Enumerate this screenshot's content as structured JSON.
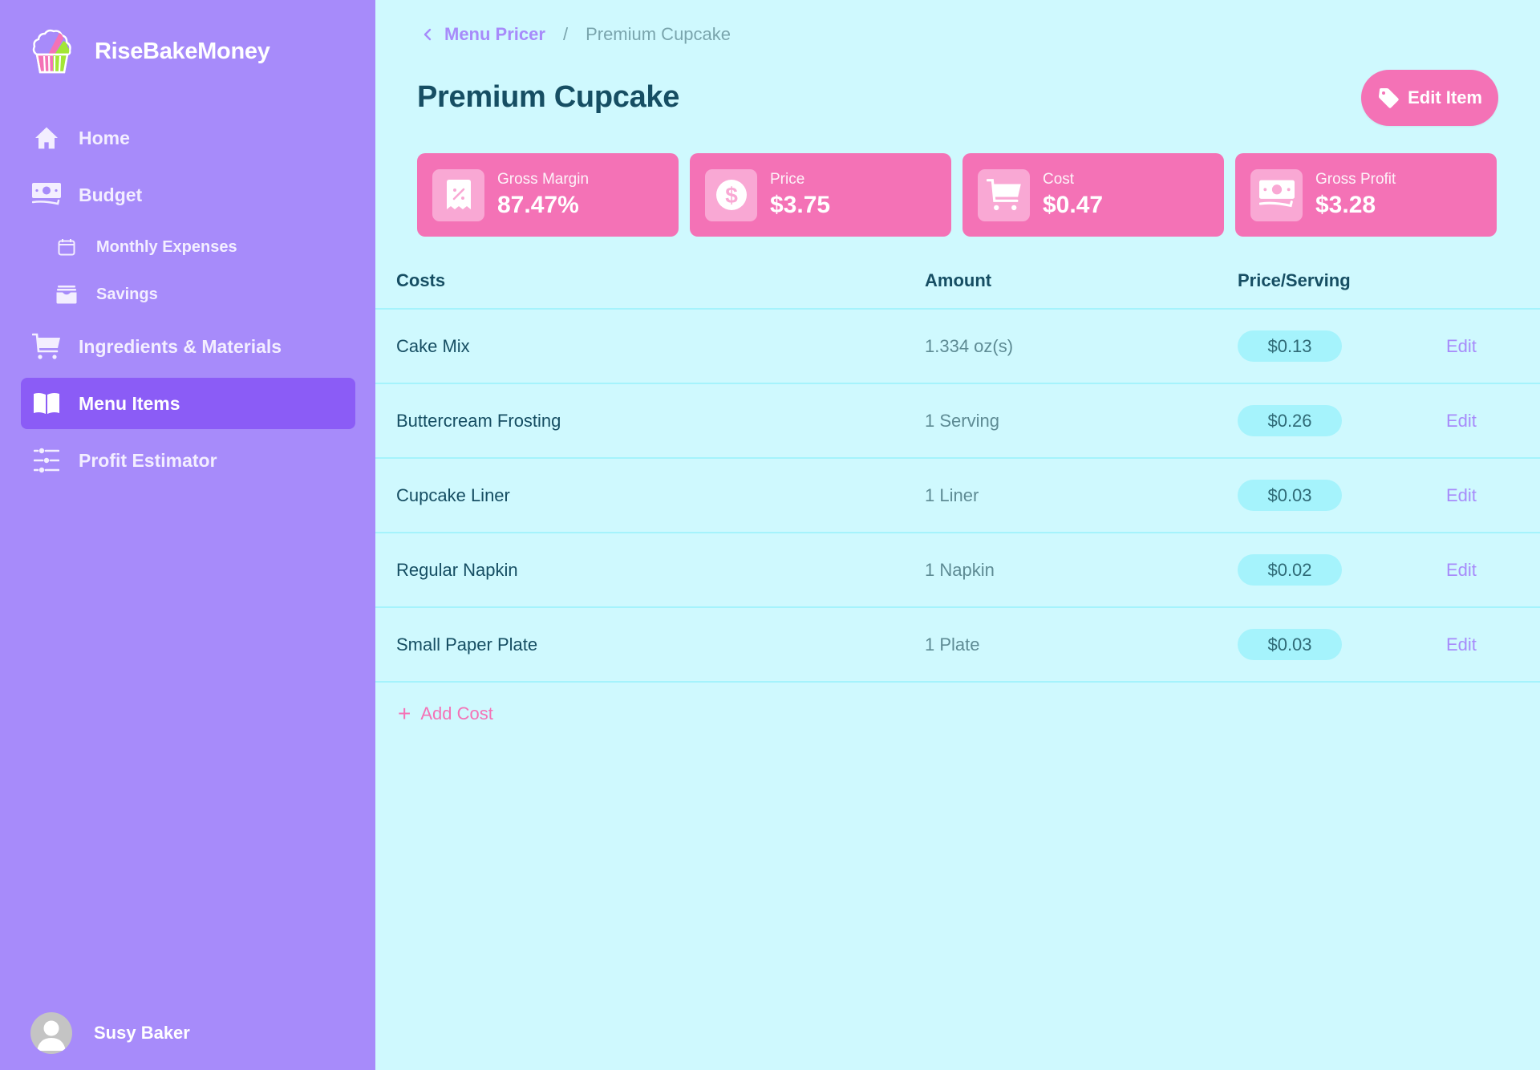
{
  "app": {
    "name": "RiseBakeMoney",
    "logo_icon": "cupcake-logo",
    "colors": {
      "sidebar_bg": "#a78bfa",
      "sidebar_active": "#8b5cf6",
      "main_bg": "#cff9fe",
      "accent_pink": "#f472b6",
      "pill_bg": "#a5f3fc",
      "title_text": "#164e63"
    }
  },
  "sidebar": {
    "items": [
      {
        "label": "Home",
        "icon": "home-icon",
        "active": false
      },
      {
        "label": "Budget",
        "icon": "banknotes-icon",
        "active": false
      },
      {
        "label": "Monthly Expenses",
        "icon": "calendar-icon",
        "active": false,
        "sub": true
      },
      {
        "label": "Savings",
        "icon": "archive-box-icon",
        "active": false,
        "sub": true
      },
      {
        "label": "Ingredients & Materials",
        "icon": "shopping-cart-icon",
        "active": false
      },
      {
        "label": "Menu Items",
        "icon": "book-open-icon",
        "active": true
      },
      {
        "label": "Profit Estimator",
        "icon": "adjustments-icon",
        "active": false
      }
    ],
    "user": {
      "name": "Susy Baker",
      "avatar_icon": "user-avatar-placeholder"
    }
  },
  "breadcrumb": {
    "back_icon": "chevron-left-icon",
    "parent": "Menu Pricer",
    "separator": "/",
    "current": "Premium Cupcake"
  },
  "page": {
    "title": "Premium Cupcake",
    "edit_button": {
      "label": "Edit Item",
      "icon": "tag-icon"
    }
  },
  "stats": [
    {
      "label": "Gross Margin",
      "value": "87.47%",
      "icon": "receipt-percent-icon"
    },
    {
      "label": "Price",
      "value": "$3.75",
      "icon": "currency-dollar-icon"
    },
    {
      "label": "Cost",
      "value": "$0.47",
      "icon": "shopping-cart-icon"
    },
    {
      "label": "Gross Profit",
      "value": "$3.28",
      "icon": "banknotes-icon"
    }
  ],
  "costs_table": {
    "headers": {
      "name": "Costs",
      "amount": "Amount",
      "price": "Price/Serving"
    },
    "rows": [
      {
        "name": "Cake Mix",
        "amount": "1.334 oz(s)",
        "price": "$0.13",
        "action": "Edit"
      },
      {
        "name": "Buttercream Frosting",
        "amount": "1 Serving",
        "price": "$0.26",
        "action": "Edit"
      },
      {
        "name": "Cupcake Liner",
        "amount": "1 Liner",
        "price": "$0.03",
        "action": "Edit"
      },
      {
        "name": "Regular Napkin",
        "amount": "1 Napkin",
        "price": "$0.02",
        "action": "Edit"
      },
      {
        "name": "Small Paper Plate",
        "amount": "1 Plate",
        "price": "$0.03",
        "action": "Edit"
      }
    ],
    "add_label": "Add Cost",
    "add_icon": "plus-icon"
  }
}
